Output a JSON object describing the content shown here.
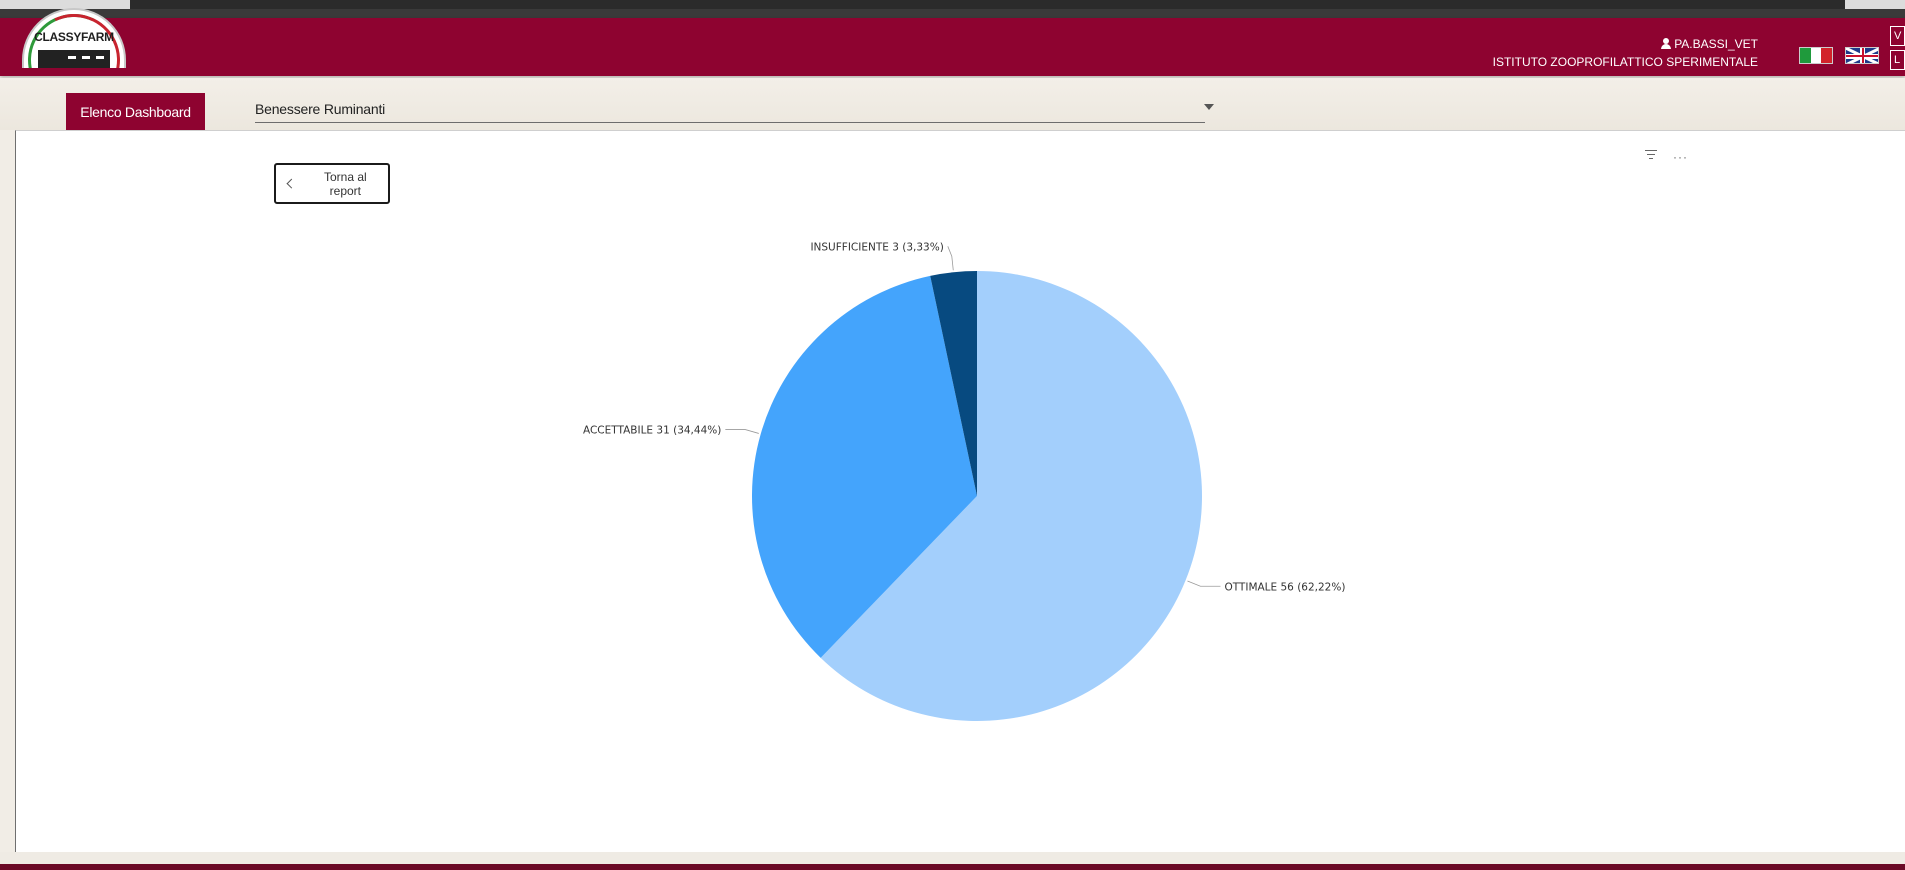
{
  "header": {
    "logo_text": "CLASSYFARM",
    "user_name": "PA.BASSI_VET",
    "organization": "ISTITUTO ZOOPROFILATTICO SPERIMENTALE",
    "side_buttons": [
      "V",
      "L"
    ]
  },
  "toolbar": {
    "dashboard_list_label": "Elenco Dashboard",
    "selected_dashboard": "Benessere Ruminanti"
  },
  "report": {
    "back_label": "Torna al report"
  },
  "icons": {
    "filter": "filter-icon",
    "more": "more-options-icon",
    "user": "person-icon",
    "dropdown": "chevron-down-icon",
    "back": "chevron-left-icon"
  },
  "colors": {
    "brand": "#8e0330",
    "ottimale": "#a3cffc",
    "accettabile": "#44a4fc",
    "insufficiente": "#074a80"
  },
  "chart_data": {
    "type": "pie",
    "slices": [
      {
        "label": "OTTIMALE 56 (62,22%)",
        "category": "OTTIMALE",
        "value": 56,
        "percent": 62.22,
        "color": "#a3cffc"
      },
      {
        "label": "ACCETTABILE 31 (34,44%)",
        "category": "ACCETTABILE",
        "value": 31,
        "percent": 34.44,
        "color": "#44a4fc"
      },
      {
        "label": "INSUFFICIENTE 3 (3,33%)",
        "category": "INSUFFICIENTE",
        "value": 3,
        "percent": 3.33,
        "color": "#074a80"
      }
    ]
  }
}
